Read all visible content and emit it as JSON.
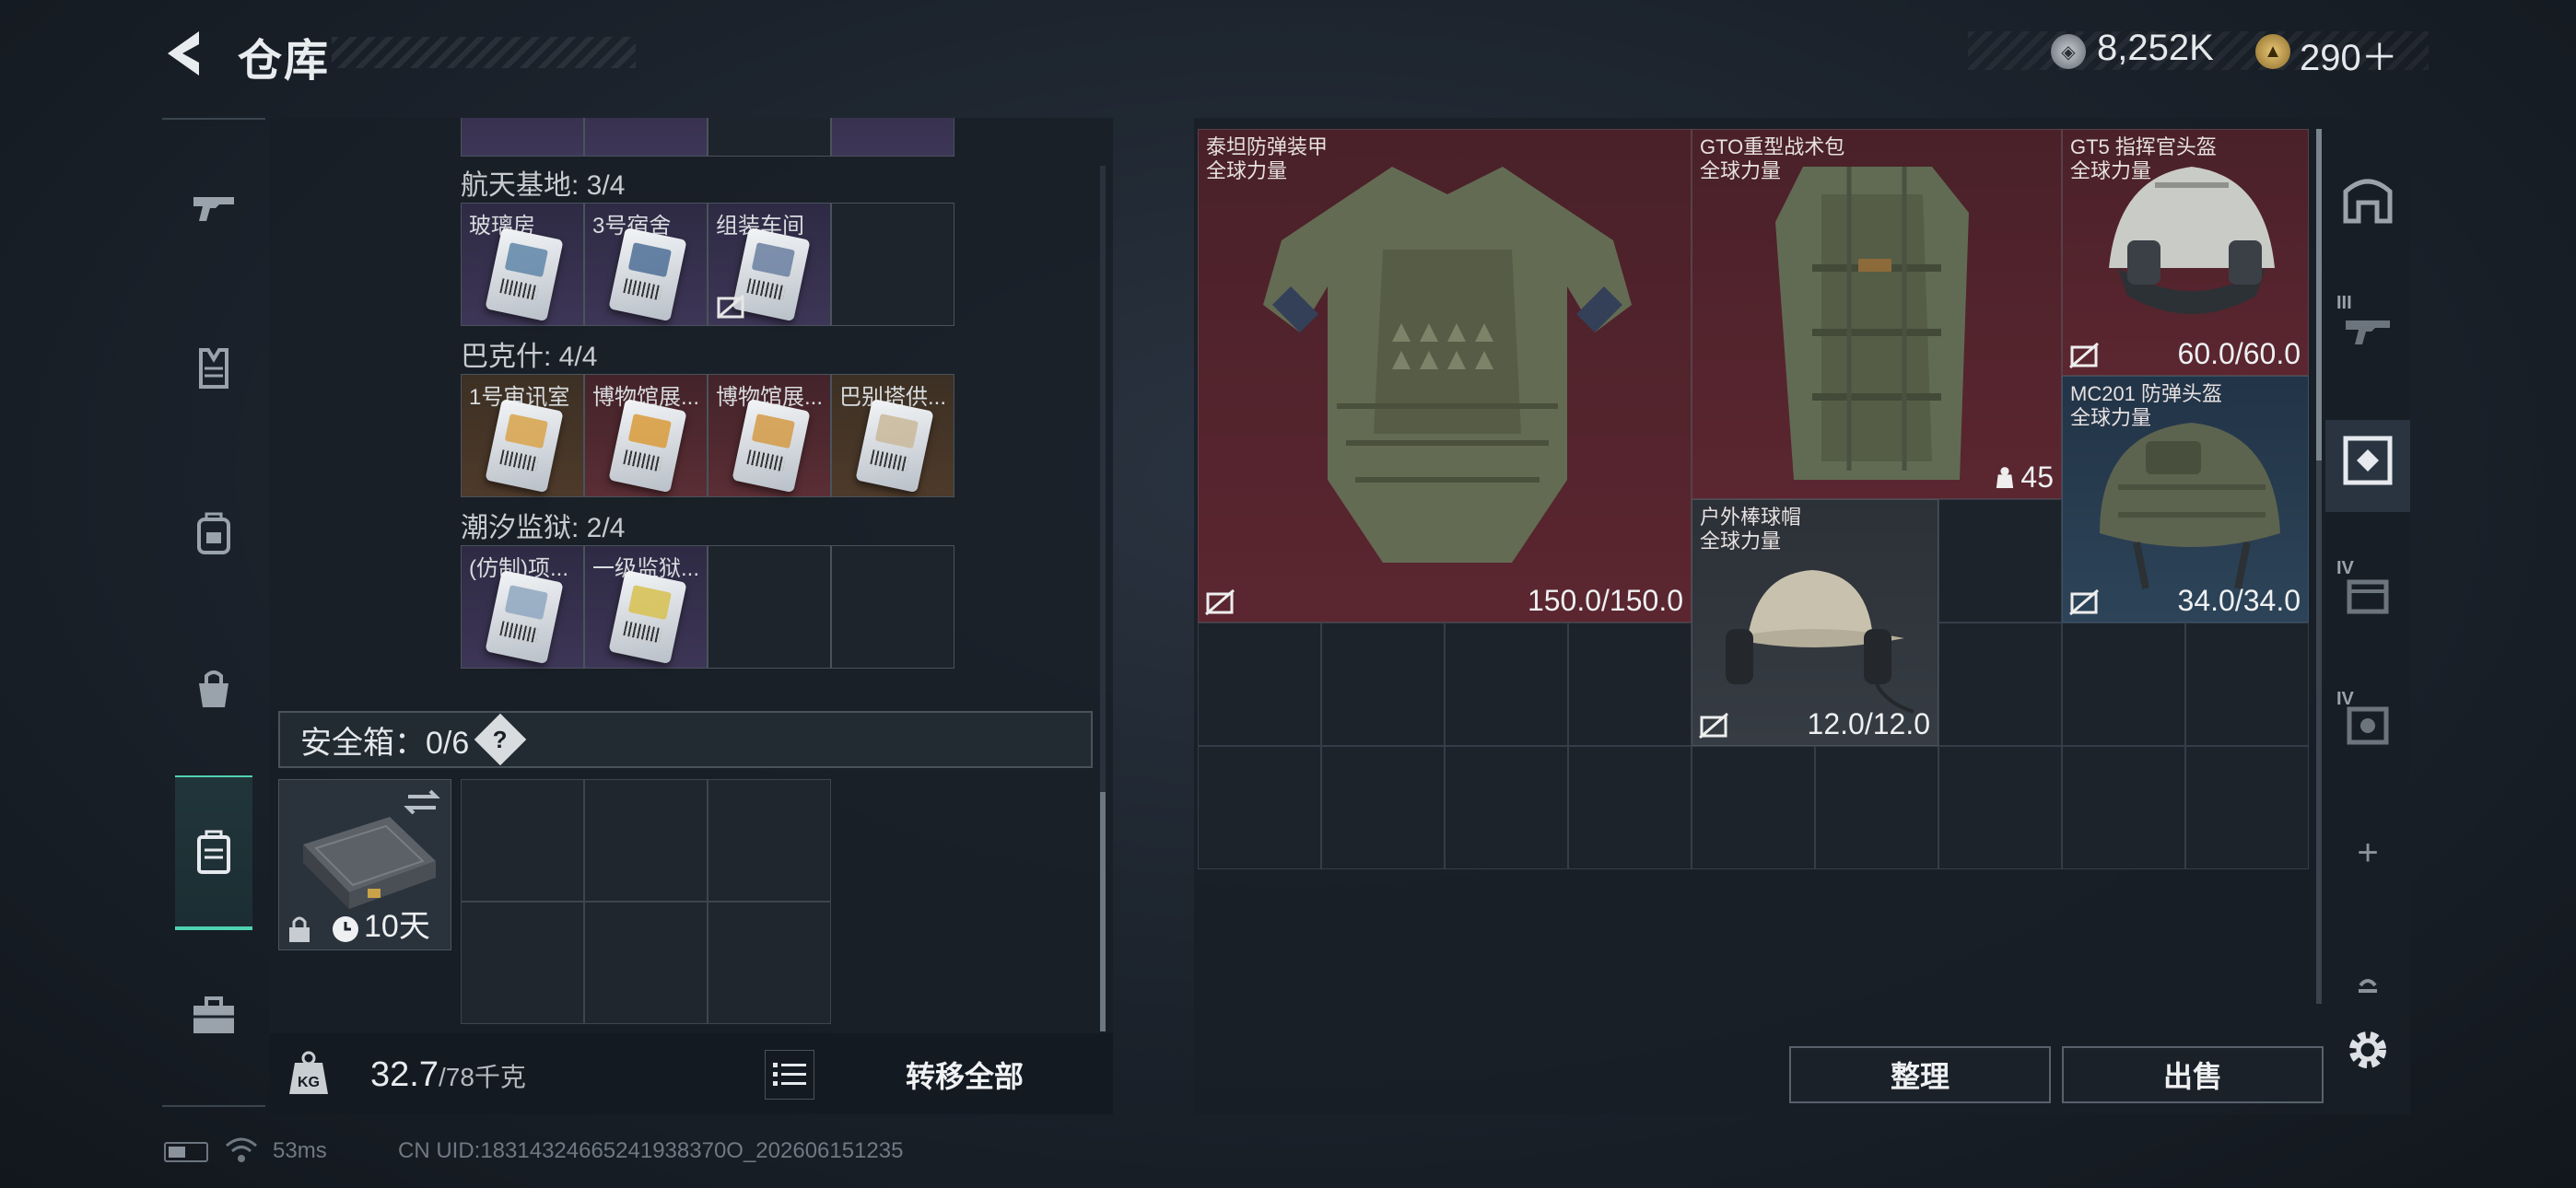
{
  "header": {
    "title": "仓库",
    "currency1": "8,252K",
    "currency2": "290＋"
  },
  "left_nav": {
    "items": [
      "weapon-icon",
      "armor-icon",
      "backpack-icon",
      "bag-icon",
      "safebox-icon",
      "toolbox-icon"
    ]
  },
  "groups": [
    {
      "title": "航天基地: 3/4",
      "items": [
        {
          "label": "玻璃房",
          "bg": "purple",
          "tint": "#5f86a8"
        },
        {
          "label": "3号宿舍",
          "bg": "purple",
          "tint": "#4d6f96"
        },
        {
          "label": "组装车间",
          "bg": "purple",
          "tint": "#6a7fa0"
        },
        {
          "label": "",
          "bg": "empty"
        }
      ]
    },
    {
      "title": "巴克什: 4/4",
      "items": [
        {
          "label": "1号审讯室",
          "bg": "brown",
          "tint": "#d8a34a"
        },
        {
          "label": "博物馆展...",
          "bg": "red",
          "tint": "#d99b3a"
        },
        {
          "label": "博物馆展...",
          "bg": "red",
          "tint": "#d39a45"
        },
        {
          "label": "巴别塔供...",
          "bg": "brown",
          "tint": "#c9b89a"
        }
      ]
    },
    {
      "title": "潮汐监狱: 2/4",
      "items": [
        {
          "label": "(仿制)项...",
          "bg": "purple",
          "tint": "#8fa7bf"
        },
        {
          "label": "一级监狱...",
          "bg": "purple",
          "tint": "#d7c150"
        },
        {
          "label": "",
          "bg": "empty"
        },
        {
          "label": "",
          "bg": "empty"
        }
      ]
    }
  ],
  "safe_box": {
    "label": "安全箱：0/6",
    "help": "?",
    "timer": "10天"
  },
  "weight": {
    "current": "32.7",
    "max": "/78千克"
  },
  "transfer_all": "转移全部",
  "items": {
    "armor": {
      "name": "泰坦防弹装甲",
      "tag": "全球力量",
      "durability": "150.0/150.0"
    },
    "pack": {
      "name": "GTO重型战术包",
      "tag": "全球力量",
      "count": "45"
    },
    "helmet1": {
      "name": "GT5 指挥官头盔",
      "tag": "全球力量",
      "durability": "60.0/60.0"
    },
    "helmet2": {
      "name": "MC201 防弹头盔",
      "tag": "全球力量",
      "durability": "34.0/34.0"
    },
    "cap": {
      "name": "户外棒球帽",
      "tag": "全球力量",
      "durability": "12.0/12.0"
    }
  },
  "buttons": {
    "sort": "整理",
    "sell": "出售"
  },
  "right_nav": {
    "slot_labels": [
      "III",
      "IV",
      "IV"
    ],
    "plus": "+"
  },
  "status": {
    "ping": "53ms",
    "uid": "CN UID:18314324665241938370O_202606151235"
  }
}
